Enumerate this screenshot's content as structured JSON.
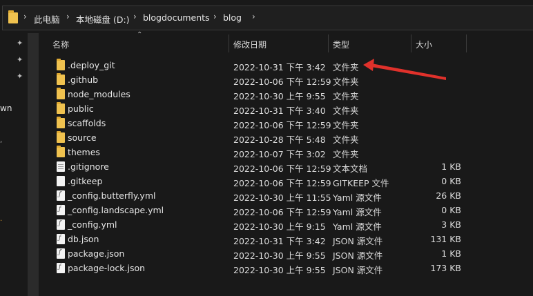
{
  "breadcrumb": [
    "此电脑",
    "本地磁盘 (D:)",
    "blogdocuments",
    "blog"
  ],
  "separator": "›",
  "columns": {
    "name": "名称",
    "date": "修改日期",
    "type": "类型",
    "size": "大小"
  },
  "nav": {
    "partial_text": "wn"
  },
  "files": [
    {
      "icon": "folder-icon",
      "name": ".deploy_git",
      "date": "2022-10-31 下午 3:42",
      "type": "文件夹",
      "size": ""
    },
    {
      "icon": "folder-icon",
      "name": ".github",
      "date": "2022-10-06 下午 12:59",
      "type": "文件夹",
      "size": ""
    },
    {
      "icon": "folder-icon",
      "name": "node_modules",
      "date": "2022-10-30 上午 9:55",
      "type": "文件夹",
      "size": ""
    },
    {
      "icon": "folder-icon",
      "name": "public",
      "date": "2022-10-31 下午 3:40",
      "type": "文件夹",
      "size": ""
    },
    {
      "icon": "folder-icon",
      "name": "scaffolds",
      "date": "2022-10-06 下午 12:59",
      "type": "文件夹",
      "size": ""
    },
    {
      "icon": "folder-icon",
      "name": "source",
      "date": "2022-10-28 下午 5:48",
      "type": "文件夹",
      "size": ""
    },
    {
      "icon": "folder-icon",
      "name": "themes",
      "date": "2022-10-07 下午 3:02",
      "type": "文件夹",
      "size": ""
    },
    {
      "icon": "text-file-icon",
      "name": ".gitignore",
      "date": "2022-10-06 下午 12:59",
      "type": "文本文档",
      "size": "1 KB"
    },
    {
      "icon": "file-icon",
      "name": ".gitkeep",
      "date": "2022-10-06 下午 12:59",
      "type": "GITKEEP 文件",
      "size": "0 KB"
    },
    {
      "icon": "yaml-file-icon",
      "name": "_config.butterfly.yml",
      "date": "2022-10-30 上午 11:55",
      "type": "Yaml 源文件",
      "size": "26 KB"
    },
    {
      "icon": "yaml-file-icon",
      "name": "_config.landscape.yml",
      "date": "2022-10-06 下午 12:59",
      "type": "Yaml 源文件",
      "size": "0 KB"
    },
    {
      "icon": "yaml-file-icon",
      "name": "_config.yml",
      "date": "2022-10-30 上午 9:15",
      "type": "Yaml 源文件",
      "size": "3 KB"
    },
    {
      "icon": "json-file-icon",
      "name": "db.json",
      "date": "2022-10-31 下午 3:42",
      "type": "JSON 源文件",
      "size": "131 KB"
    },
    {
      "icon": "json-file-icon",
      "name": "package.json",
      "date": "2022-10-30 上午 9:55",
      "type": "JSON 源文件",
      "size": "1 KB"
    },
    {
      "icon": "json-file-icon",
      "name": "package-lock.json",
      "date": "2022-10-30 上午 9:55",
      "type": "JSON 源文件",
      "size": "173 KB"
    }
  ],
  "annotation_color": "#e0312b"
}
